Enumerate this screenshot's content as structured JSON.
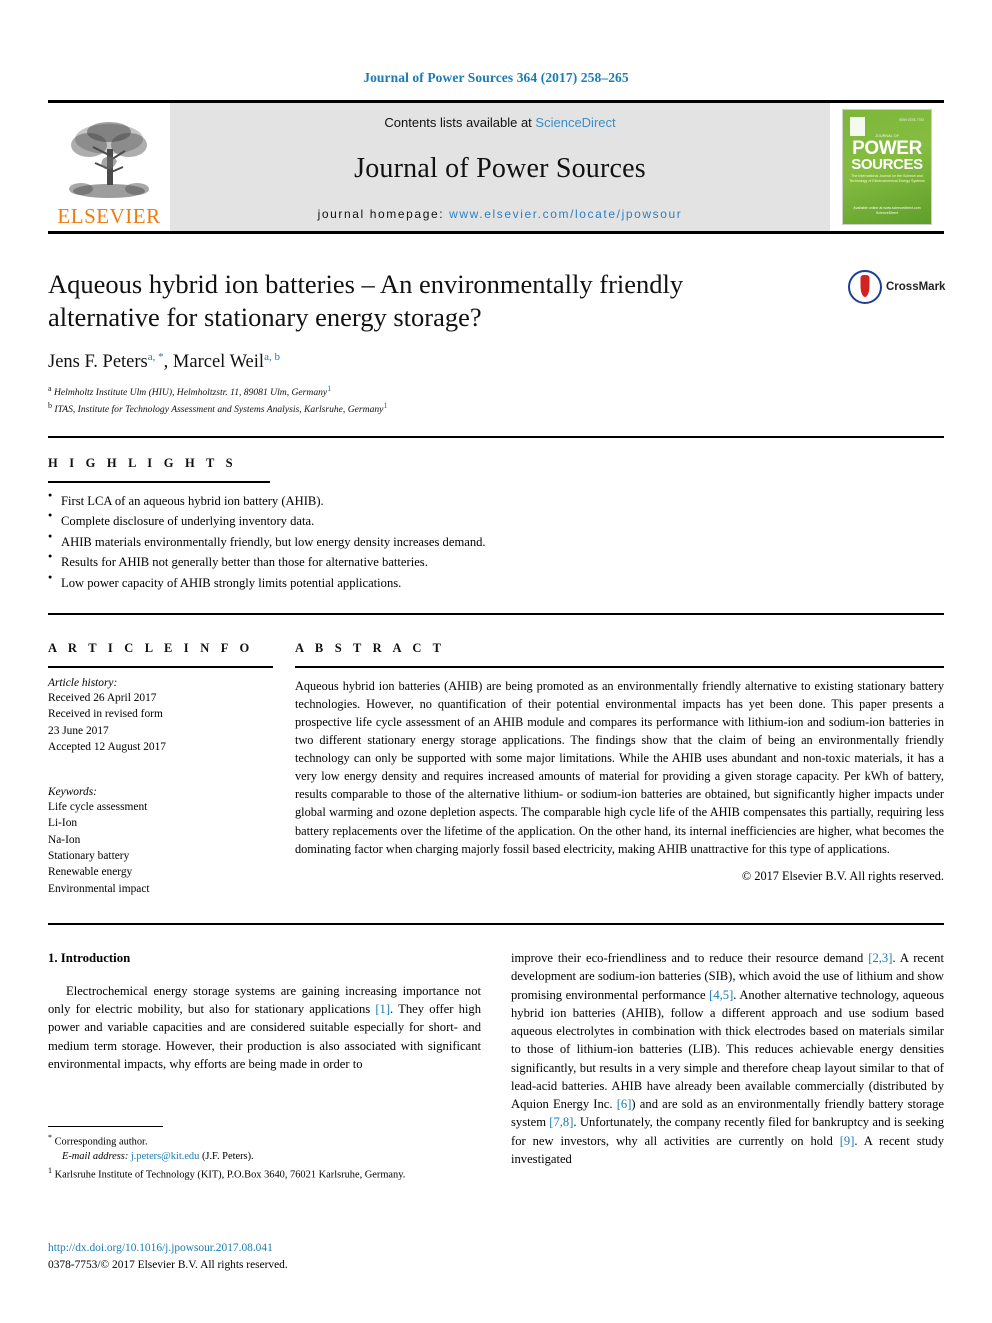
{
  "running_head": "Journal of Power Sources 364 (2017) 258–265",
  "masthead": {
    "contents_prefix": "Contents lists available at",
    "sciencedirect": "ScienceDirect",
    "journal_title": "Journal of Power Sources",
    "homepage_prefix": "journal homepage:",
    "homepage_url": "www.elsevier.com/locate/jpowsour",
    "publisher": "ELSEVIER",
    "cover": {
      "power": "POWER",
      "sources": "SOURCES",
      "issn": "ISSN 0378-7753",
      "sub": "JOURNAL OF",
      "tagline": "The International Journal on the Science and Technology of Electrochemical Energy Systems",
      "footer": "Available online at www.sciencedirect.com ScienceDirect"
    }
  },
  "article": {
    "title": "Aqueous hybrid ion batteries – An environmentally friendly alternative for stationary energy storage?",
    "authors": [
      {
        "name": "Jens F. Peters",
        "marks": "a, *"
      },
      {
        "name": "Marcel Weil",
        "marks": "a, b"
      }
    ],
    "affiliations": [
      {
        "mark": "a",
        "text": "Helmholtz Institute Ulm (HIU), Helmholtzstr. 11, 89081 Ulm, Germany",
        "note": "1"
      },
      {
        "mark": "b",
        "text": "ITAS, Institute for Technology Assessment and Systems Analysis, Karlsruhe, Germany",
        "note": "1"
      }
    ],
    "crossmark_label": "CrossMark"
  },
  "highlights": {
    "heading": "H I G H L I G H T S",
    "items": [
      "First LCA of an aqueous hybrid ion battery (AHIB).",
      "Complete disclosure of underlying inventory data.",
      "AHIB materials environmentally friendly, but low energy density increases demand.",
      "Results for AHIB not generally better than those for alternative batteries.",
      "Low power capacity of AHIB strongly limits potential applications."
    ]
  },
  "article_info": {
    "heading": "A R T I C L E  I N F O",
    "history_label": "Article history:",
    "history": [
      "Received 26 April 2017",
      "Received in revised form",
      "23 June 2017",
      "Accepted 12 August 2017"
    ],
    "keywords_label": "Keywords:",
    "keywords": [
      "Life cycle assessment",
      "Li-Ion",
      "Na-Ion",
      "Stationary battery",
      "Renewable energy",
      "Environmental impact"
    ]
  },
  "abstract": {
    "heading": "A B S T R A C T",
    "text": "Aqueous hybrid ion batteries (AHIB) are being promoted as an environmentally friendly alternative to existing stationary battery technologies. However, no quantification of their potential environmental impacts has yet been done. This paper presents a prospective life cycle assessment of an AHIB module and compares its performance with lithium-ion and sodium-ion batteries in two different stationary energy storage applications. The findings show that the claim of being an environmentally friendly technology can only be supported with some major limitations. While the AHIB uses abundant and non-toxic materials, it has a very low energy density and requires increased amounts of material for providing a given storage capacity. Per kWh of battery, results comparable to those of the alternative lithium- or sodium-ion batteries are obtained, but significantly higher impacts under global warming and ozone depletion aspects. The comparable high cycle life of the AHIB compensates this partially, requiring less battery replacements over the lifetime of the application. On the other hand, its internal inefficiencies are higher, what becomes the dominating factor when charging majorly fossil based electricity, making AHIB unattractive for this type of applications.",
    "copyright": "© 2017 Elsevier B.V. All rights reserved."
  },
  "body": {
    "section_number_title": "1. Introduction",
    "left_paragraph_prefix": "Electrochemical energy storage systems are gaining increasing importance not only for electric mobility, but also for stationary applications ",
    "left_cite_1": "[1]",
    "left_paragraph_mid": ". They offer high power and variable capacities and are considered suitable especially for short- and medium term storage. However, their production is also associated with significant environmental impacts, why efforts are being made in order to",
    "right_part_1": "improve their eco-friendliness and to reduce their resource demand ",
    "right_cite_23": "[2,3]",
    "right_part_2": ". A recent development are sodium-ion batteries (SIB), which avoid the use of lithium and show promising environmental performance ",
    "right_cite_45": "[4,5]",
    "right_part_3": ". Another alternative technology, aqueous hybrid ion batteries (AHIB), follow a different approach and use sodium based aqueous electrolytes in combination with thick electrodes based on materials similar to those of lithium-ion batteries (LIB). This reduces achievable energy densities significantly, but results in a very simple and therefore cheap layout similar to that of lead-acid batteries. AHIB have already been available commercially (distributed by Aquion Energy Inc. ",
    "right_cite_6": "[6]",
    "right_part_4": ") and are sold as an environmentally friendly battery storage system ",
    "right_cite_78": "[7,8]",
    "right_part_5": ". Unfortunately, the company recently filed for bankruptcy and is seeking for new investors, why all activities are currently on hold ",
    "right_cite_9": "[9]",
    "right_part_6": ". A recent study investigated"
  },
  "footnotes": {
    "corresponding": "Corresponding author.",
    "email_label": "E-mail address:",
    "email": "j.peters@kit.edu",
    "email_suffix": "(J.F. Peters).",
    "note_mark": "1",
    "note_text": "Karlsruhe Institute of Technology (KIT), P.O.Box 3640, 76021 Karlsruhe, Germany."
  },
  "doi_block": {
    "doi": "http://dx.doi.org/10.1016/j.jpowsour.2017.08.041",
    "issn_line": "0378-7753/© 2017 Elsevier B.V. All rights reserved."
  },
  "colors": {
    "link_blue": "#1a7bb5",
    "elsevier_orange": "#ef7b10",
    "cover_green": "#7cb63a",
    "masthead_gray": "#e3e3e3"
  }
}
